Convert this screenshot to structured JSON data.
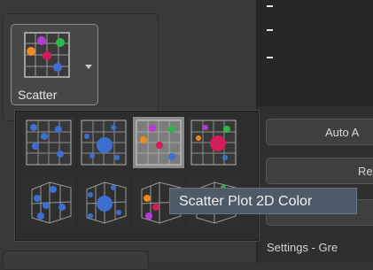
{
  "ribbon": {
    "scatter_button_label": "Scatter",
    "scatter_icon": "scatter-plot-2d-color-icon",
    "dropdown_icon": "chevron-down-icon"
  },
  "gallery": {
    "items": [
      {
        "name": "scatter-plot-2d",
        "icon": "scatter-2d-icon"
      },
      {
        "name": "bubble-plot-2d",
        "icon": "bubble-2d-icon"
      },
      {
        "name": "scatter-plot-2d-color",
        "icon": "scatter-2d-color-icon"
      },
      {
        "name": "bubble-plot-2d-color",
        "icon": "bubble-2d-color-icon"
      },
      {
        "name": "scatter-plot-3d",
        "icon": "scatter-3d-icon"
      },
      {
        "name": "bubble-plot-3d",
        "icon": "bubble-3d-icon"
      },
      {
        "name": "scatter-plot-3d-color",
        "icon": "scatter-3d-color-icon"
      },
      {
        "name": "bubble-plot-3d-color",
        "icon": "bubble-3d-color-icon"
      }
    ],
    "selected_index": 2
  },
  "tooltip": {
    "text": "Scatter Plot 2D Color"
  },
  "right_panel": {
    "button1_label": "Auto A",
    "button2_label": "Res",
    "button3_label": "",
    "settings_label": "Settings - Gre"
  },
  "colors": {
    "tooltip_bg": "#4e5a68",
    "selected_thumb": "#8a8a8a",
    "accent": "#3d6fd1"
  }
}
